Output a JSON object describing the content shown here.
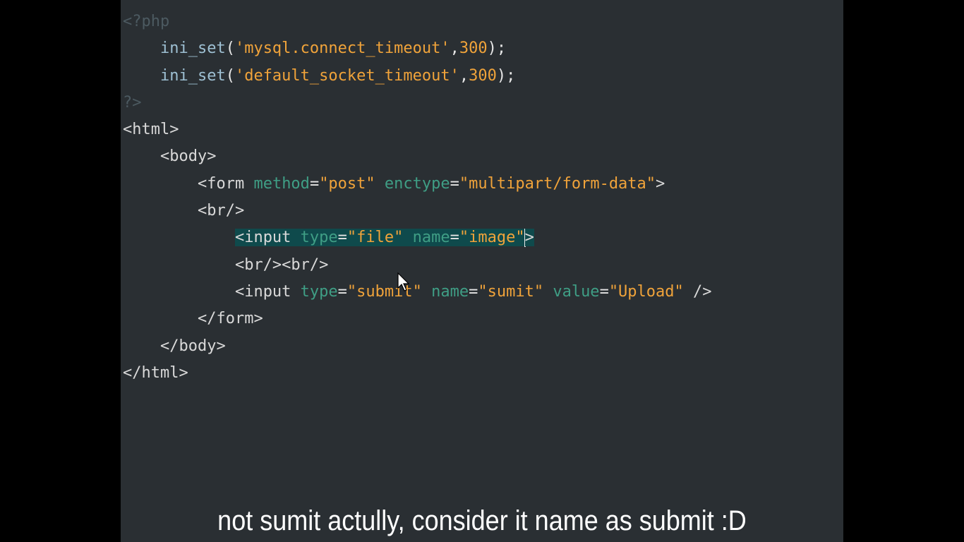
{
  "colors": {
    "background": "#2a2f33",
    "tag": "#d9d9d9",
    "attr": "#3f9e85",
    "string": "#f0a33a",
    "php_tag": "#4c5a61",
    "func": "#9ec0d3",
    "punct": "#e6e6e6",
    "number": "#f0a33a",
    "selection": "#0f4a4c",
    "subtitle": "#ffffff"
  },
  "code_lines": [
    [
      {
        "t": "<?php",
        "c": "php_tag"
      }
    ],
    [
      {
        "t": "    ",
        "c": "punct"
      },
      {
        "t": "ini_set",
        "c": "func"
      },
      {
        "t": "(",
        "c": "punct"
      },
      {
        "t": "'mysql.connect_timeout'",
        "c": "string"
      },
      {
        "t": ",",
        "c": "punct"
      },
      {
        "t": "300",
        "c": "number"
      },
      {
        "t": ");",
        "c": "punct"
      }
    ],
    [
      {
        "t": "    ",
        "c": "punct"
      },
      {
        "t": "ini_set",
        "c": "func"
      },
      {
        "t": "(",
        "c": "punct"
      },
      {
        "t": "'default_socket_timeout'",
        "c": "string"
      },
      {
        "t": ",",
        "c": "punct"
      },
      {
        "t": "300",
        "c": "number"
      },
      {
        "t": ");",
        "c": "punct"
      }
    ],
    [
      {
        "t": "?>",
        "c": "php_tag"
      }
    ],
    [
      {
        "t": "<html>",
        "c": "tag"
      }
    ],
    [
      {
        "t": "    ",
        "c": "punct"
      },
      {
        "t": "<body>",
        "c": "tag"
      }
    ],
    [
      {
        "t": "        ",
        "c": "punct"
      },
      {
        "t": "<form ",
        "c": "tag"
      },
      {
        "t": "method",
        "c": "attr"
      },
      {
        "t": "=",
        "c": "punct"
      },
      {
        "t": "\"post\"",
        "c": "string"
      },
      {
        "t": " ",
        "c": "punct"
      },
      {
        "t": "enctype",
        "c": "attr"
      },
      {
        "t": "=",
        "c": "punct"
      },
      {
        "t": "\"multipart/form-data\"",
        "c": "string"
      },
      {
        "t": ">",
        "c": "tag"
      }
    ],
    [
      {
        "t": "        ",
        "c": "punct"
      },
      {
        "t": "<br/>",
        "c": "tag"
      }
    ],
    [
      {
        "t": "            ",
        "c": "punct"
      },
      {
        "t": "<input ",
        "c": "tag",
        "hl": true
      },
      {
        "t": "type",
        "c": "attr",
        "hl": true
      },
      {
        "t": "=",
        "c": "punct",
        "hl": true
      },
      {
        "t": "\"file\"",
        "c": "string",
        "hl": true
      },
      {
        "t": " ",
        "c": "punct",
        "hl": true
      },
      {
        "t": "name",
        "c": "attr",
        "hl": true
      },
      {
        "t": "=",
        "c": "punct",
        "hl": true
      },
      {
        "t": "\"image\"",
        "c": "string",
        "hl": true
      },
      {
        "cursor": true
      },
      {
        "t": ">",
        "c": "tag",
        "hl": true
      }
    ],
    [
      {
        "t": "            ",
        "c": "punct"
      },
      {
        "t": "<br/><br/>",
        "c": "tag"
      }
    ],
    [
      {
        "t": "            ",
        "c": "punct"
      },
      {
        "t": "<input ",
        "c": "tag"
      },
      {
        "t": "type",
        "c": "attr"
      },
      {
        "t": "=",
        "c": "punct"
      },
      {
        "t": "\"submit\"",
        "c": "string"
      },
      {
        "t": " ",
        "c": "punct"
      },
      {
        "t": "name",
        "c": "attr"
      },
      {
        "t": "=",
        "c": "punct"
      },
      {
        "t": "\"sumit\"",
        "c": "string"
      },
      {
        "t": " ",
        "c": "punct"
      },
      {
        "t": "value",
        "c": "attr"
      },
      {
        "t": "=",
        "c": "punct"
      },
      {
        "t": "\"Upload\"",
        "c": "string"
      },
      {
        "t": " />",
        "c": "tag"
      }
    ],
    [
      {
        "t": "        ",
        "c": "punct"
      },
      {
        "t": "</form>",
        "c": "tag"
      }
    ],
    [
      {
        "t": "    ",
        "c": "punct"
      },
      {
        "t": "</body>",
        "c": "tag"
      }
    ],
    [
      {
        "t": "</html>",
        "c": "tag"
      }
    ]
  ],
  "subtitle": "not sumit actully, consider it name as submit :D",
  "icons": {
    "mouse_cursor": "arrow-pointer-icon"
  }
}
